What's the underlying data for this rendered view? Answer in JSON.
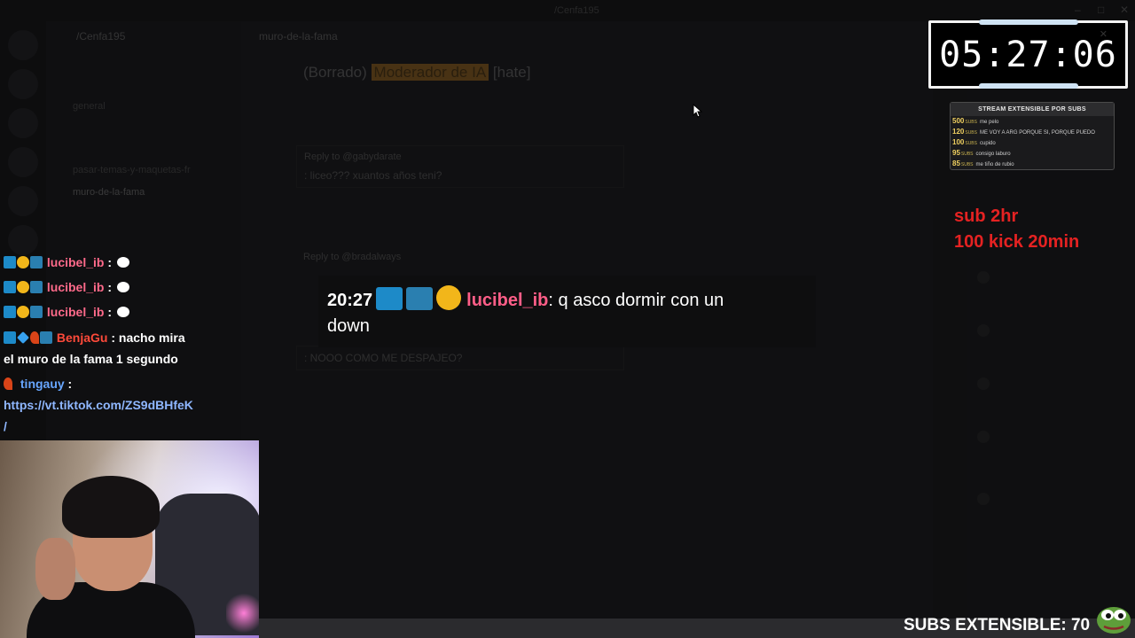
{
  "discord": {
    "window_title": "/Cenfa195",
    "server_name": "/Cenfa195",
    "channel_name": "muro-de-la-fama",
    "channels": [
      "general",
      "pasar-temas-y-maquetas-fr",
      "muro-de-la-fama"
    ],
    "pinned_line": {
      "prefix": "(Borrado)",
      "role": "Moderador de IA",
      "suffix": "[hate]"
    },
    "replies": [
      {
        "reply_to": "Reply to @gabydarate",
        "text": ": liceo??? xuantos años teni?"
      },
      {
        "reply_to": "Reply to @bradalways",
        "text": ": NOOO COMO ME DESPAJEO?"
      }
    ]
  },
  "timer": {
    "value": "05:27:06"
  },
  "sub_goals": {
    "header": "STREAM EXTENSIBLE POR SUBS",
    "unit": "SUBS",
    "items": [
      {
        "count": "500",
        "text": "me pelo"
      },
      {
        "count": "120",
        "text": "ME VOY A ARG PORQUE SI, PORQUE PUEDO"
      },
      {
        "count": "100",
        "text": "cupido"
      },
      {
        "count": "95",
        "text": "consigo laburo"
      },
      {
        "count": "85",
        "text": "me tiño de rubio"
      }
    ]
  },
  "rules": {
    "line1": "sub 2hr",
    "line2": "100 kick 20min"
  },
  "chat": [
    {
      "user": "lucibel_ib",
      "sep": " :",
      "text": ""
    },
    {
      "user": "lucibel_ib",
      "sep": " :",
      "text": ""
    },
    {
      "user": "lucibel_ib",
      "sep": " :",
      "text": ""
    },
    {
      "user": "BenjaGu",
      "sep": " :",
      "text": " nacho mira",
      "text2": "el muro de la fama 1 segundo"
    },
    {
      "user": "tingauy",
      "sep": " :",
      "text": "",
      "link": "https://vt.tiktok.com/ZS9dBHfeK",
      "link2": "/"
    }
  ],
  "highlight": {
    "time": "20:27",
    "user": "lucibel_ib",
    "message_1": ": q asco dormir con un",
    "message_2": "down"
  },
  "subs_extensible": {
    "label": "SUBS EXTENSIBLE: 70"
  },
  "colors": {
    "rules_red": "#e52222",
    "name_pink": "#ff6a8a",
    "name_red": "#ff4a3a",
    "name_blue": "#67a6ff",
    "link": "#8fb7ff"
  }
}
